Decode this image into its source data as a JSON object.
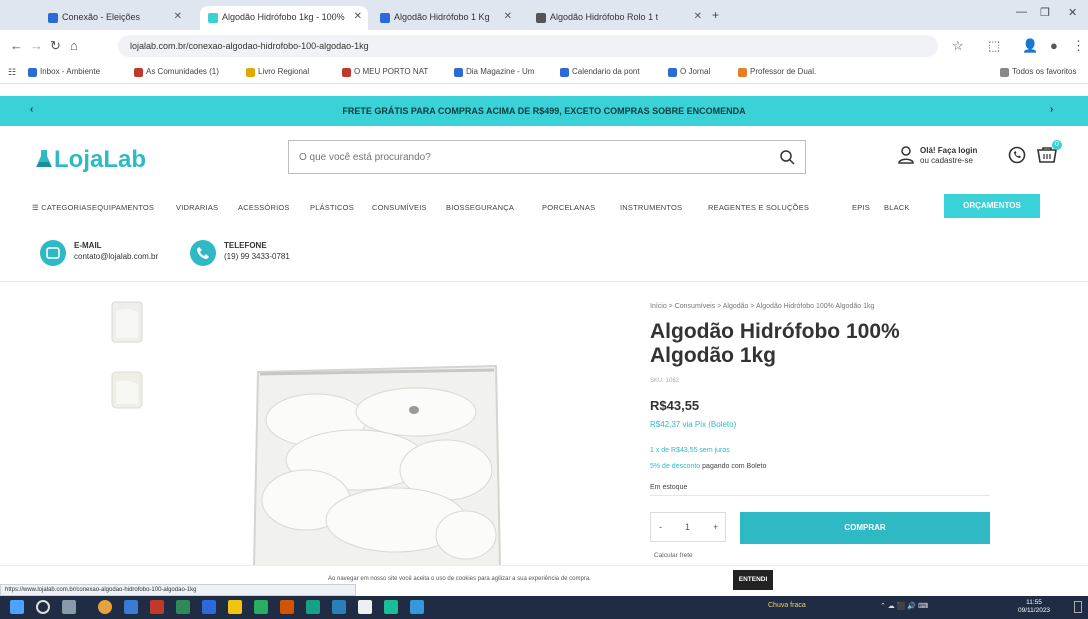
{
  "browser": {
    "tabs": [
      {
        "label": "Conexão - Eleições",
        "favicon_color": "#2b6ad8"
      },
      {
        "label": "Algodão Hidrófobo 1kg - 100%",
        "favicon_color": "#3ad2d6"
      },
      {
        "label": "Algodão Hidrófobo 1 Kg",
        "favicon_color": "#2b6ad8"
      },
      {
        "label": "Algodão Hidrófobo Rolo 1 t",
        "favicon_color": "#555555"
      }
    ],
    "new_tab": "+",
    "url": "lojalab.com.br/conexao-algodao-hidrofobo-100-algodao-1kg",
    "bookmarks": [
      {
        "label": "Inbox - Ambiente",
        "color": "#2b6ad8"
      },
      {
        "label": "As Comunidades (1)",
        "color": "#c0392b"
      },
      {
        "label": "Livro Regional",
        "color": "#e0a800"
      },
      {
        "label": "O MEU PORTO NAT",
        "color": "#c0392b"
      },
      {
        "label": "Dia Magazine - Um",
        "color": "#2b6ad8"
      },
      {
        "label": "Calendario da pont",
        "color": "#2b6ad8"
      },
      {
        "label": "O Jornal",
        "color": "#2b6ad8"
      },
      {
        "label": "Professor de Dual.",
        "color": "#e67e22"
      }
    ],
    "other_bookmarks": "Todos os favoritos"
  },
  "site": {
    "announcement": "FRETE GRÁTIS PARA COMPRAS ACIMA DE R$499, EXCETO COMPRAS SOBRE ENCOMENDA",
    "logo": "LojaLab",
    "search_placeholder": "O que você está procurando?",
    "account": {
      "line1": "Olá! Faça login",
      "line2": "ou cadastre-se"
    },
    "cart_count": "0",
    "nav": [
      "CATEGORIAS",
      "EQUIPAMENTOS",
      "VIDRARIAS",
      "ACESSÓRIOS",
      "PLÁSTICOS",
      "CONSUMÍVEIS",
      "BIOSSEGURANÇA",
      "PORCELANAS",
      "INSTRUMENTOS",
      "REAGENTES E SOLUÇÕES",
      "EPIS",
      "BLACK"
    ],
    "nav_highlight": "ORÇAMENTOS",
    "contact_email": {
      "title": "E-MAIL",
      "value": "contato@lojalab.com.br"
    },
    "contact_phone": {
      "title": "TELEFONE",
      "value": "(19) 99 3433-0781"
    }
  },
  "product": {
    "breadcrumb": "Início > Consumíveis > Algodão > Algodão Hidrófobo 100% Algodão 1kg",
    "title": "Algodão Hidrófobo 100% Algodão 1kg",
    "sku": "SKU: 1062",
    "price": "R$43,55",
    "pix_price": "R$42,37 via Pix (Boleto)",
    "installments": "1 x de R$43,55 sem juros",
    "preorder_highlight": "5% de desconto",
    "preorder_rest": "pagando com Boleto",
    "stock": "Em estoque",
    "qty_minus": "-",
    "qty_value": "1",
    "qty_plus": "+",
    "buy_label": "COMPRAR",
    "shipping": "Calcular frete"
  },
  "cookie": {
    "text": "Ao navegar em nosso site você aceita o uso de cookies para agilizar a sua experiência de compra.",
    "button": "ENTENDI"
  },
  "status_url": "https://www.lojalab.com.br/conexao-algodao-hidrofobo-100-algodao-1kg",
  "taskbar": {
    "weather": "Chuva fraca",
    "clock_time": "11:55",
    "clock_date": "09/11/2023"
  }
}
